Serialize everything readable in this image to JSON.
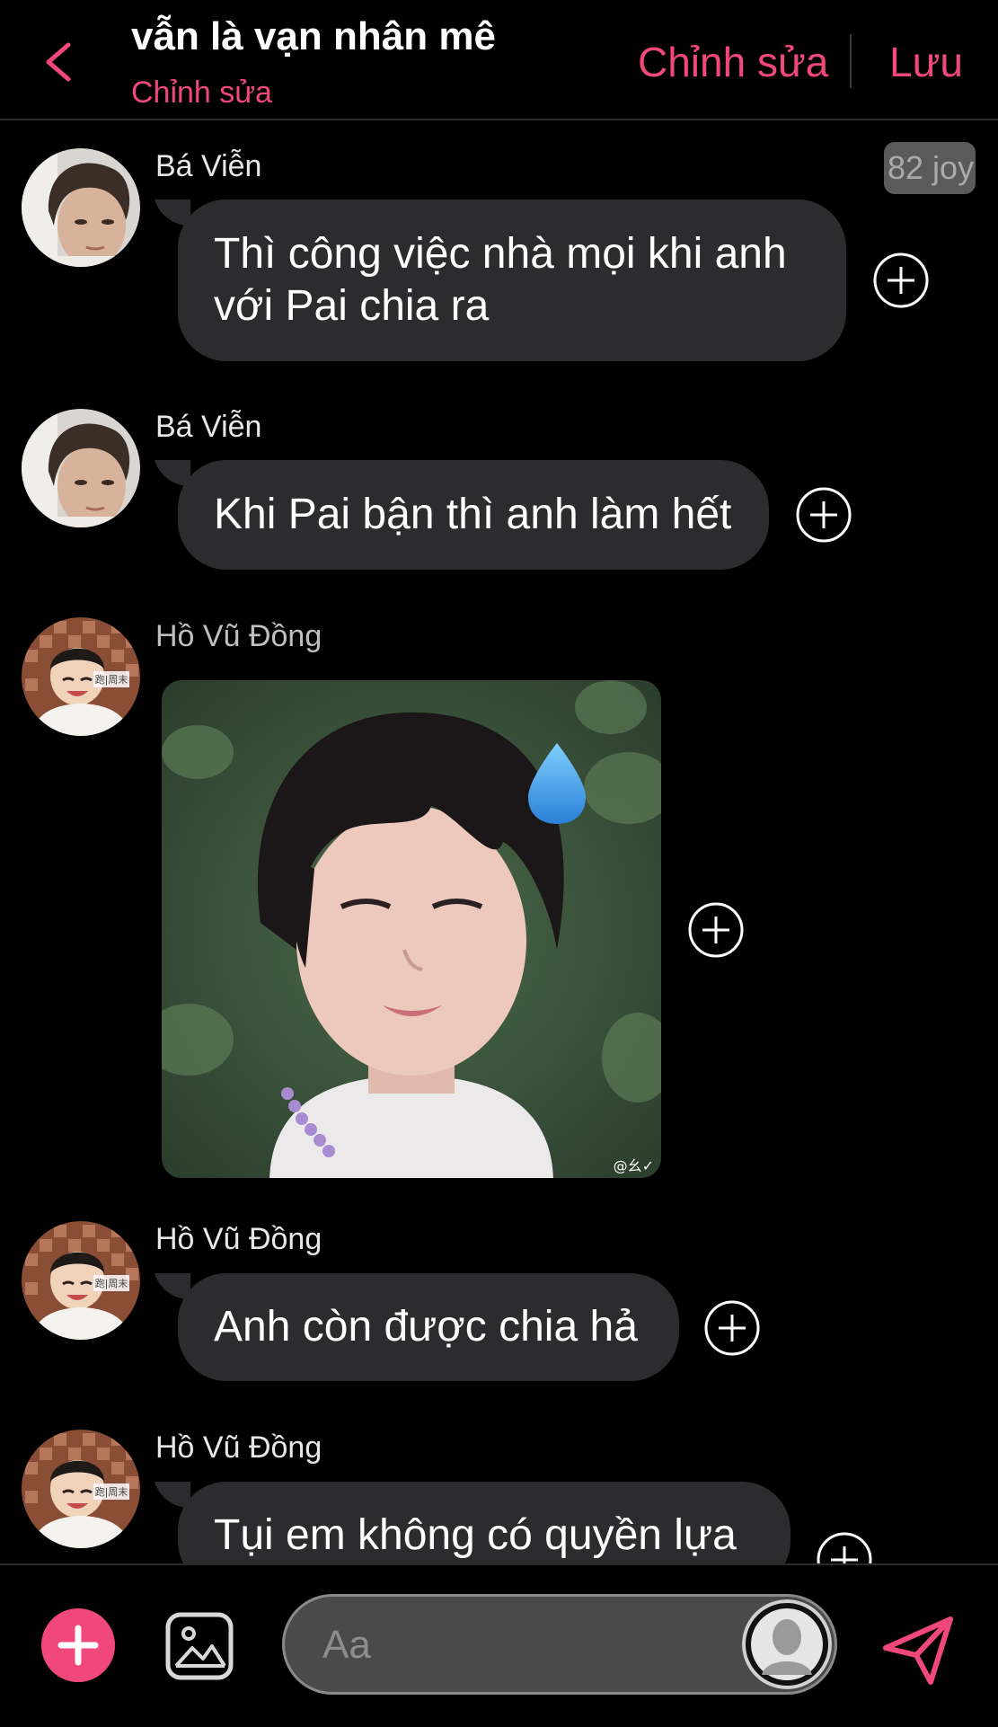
{
  "header": {
    "title": "vẫn là vạn nhân mê",
    "subtitle": "Chỉnh sửa",
    "edit_label": "Chỉnh sửa",
    "save_label": "Lưu"
  },
  "badge": {
    "text": "82 joy"
  },
  "messages": [
    {
      "sender": "Bá Viễn",
      "type": "text",
      "lines": [
        "Thì công việc nhà mọi khi anh",
        "với Pai chia ra"
      ]
    },
    {
      "sender": "Bá Viễn",
      "type": "text",
      "text": "Khi Pai bận thì anh làm hết"
    },
    {
      "sender": "Hồ Vũ Đồng",
      "type": "image",
      "watermark": "@幺✓"
    },
    {
      "sender": "Hồ Vũ Đồng",
      "type": "text",
      "text": "Anh còn được chia hả"
    },
    {
      "sender": "Hồ Vũ Đồng",
      "type": "text",
      "text": "Tụi em không có quyền lựa"
    }
  ],
  "avatar_badge_text": "跑|周末",
  "composer": {
    "placeholder": "Aa"
  },
  "colors": {
    "accent": "#f0487a",
    "bubble": "#2c2c2e",
    "background": "#000000"
  }
}
